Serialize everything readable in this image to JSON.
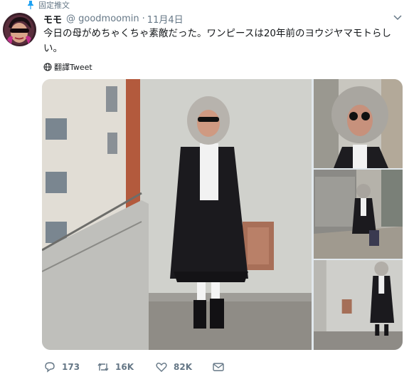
{
  "pinned": {
    "label": "固定推文",
    "icon": "pin-icon"
  },
  "author": {
    "display_name": "モモ",
    "handle": "@ goodmoomin",
    "separator": "·",
    "time": "11月4日",
    "avatar_icon": "avatar"
  },
  "tweet": {
    "text": "今日の母がめちゃくちゃ素敵だった。ワンピースは20年前のヨウジヤマモトらしい。"
  },
  "translate": {
    "label": "翻譯Tweet",
    "icon": "globe-icon"
  },
  "media": {
    "count": 4
  },
  "actions": {
    "reply": {
      "count": "173",
      "icon": "reply-icon"
    },
    "retweet": {
      "count": "16K",
      "icon": "retweet-icon"
    },
    "like": {
      "count": "82K",
      "icon": "heart-icon"
    },
    "dm": {
      "icon": "mail-icon"
    }
  },
  "colors": {
    "text": "#14171a",
    "secondary": "#657786",
    "accent": "#1da1f2"
  }
}
